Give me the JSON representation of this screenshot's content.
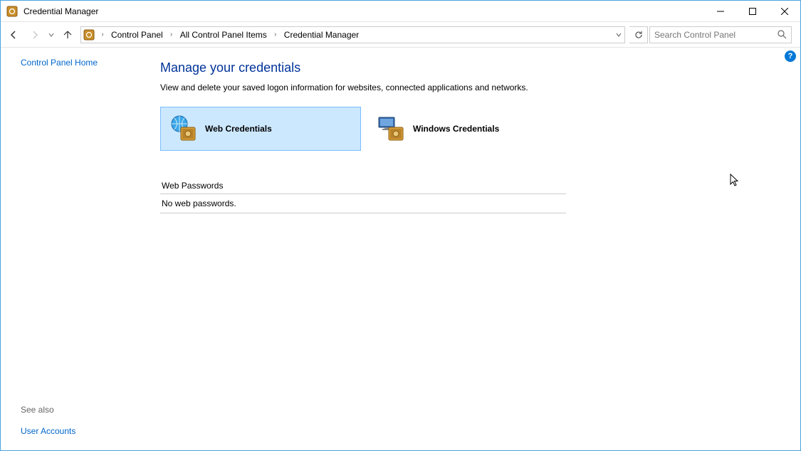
{
  "window": {
    "title": "Credential Manager"
  },
  "breadcrumb": {
    "root": "Control Panel",
    "mid": "All Control Panel Items",
    "leaf": "Credential Manager"
  },
  "search": {
    "placeholder": "Search Control Panel"
  },
  "sidebar": {
    "home": "Control Panel Home",
    "seealso_heading": "See also",
    "seealso_link": "User Accounts"
  },
  "main": {
    "heading": "Manage your credentials",
    "description": "View and delete your saved logon information for websites, connected applications and networks.",
    "tile_web": "Web Credentials",
    "tile_windows": "Windows Credentials",
    "section_heading": "Web Passwords",
    "section_empty": "No web passwords."
  }
}
